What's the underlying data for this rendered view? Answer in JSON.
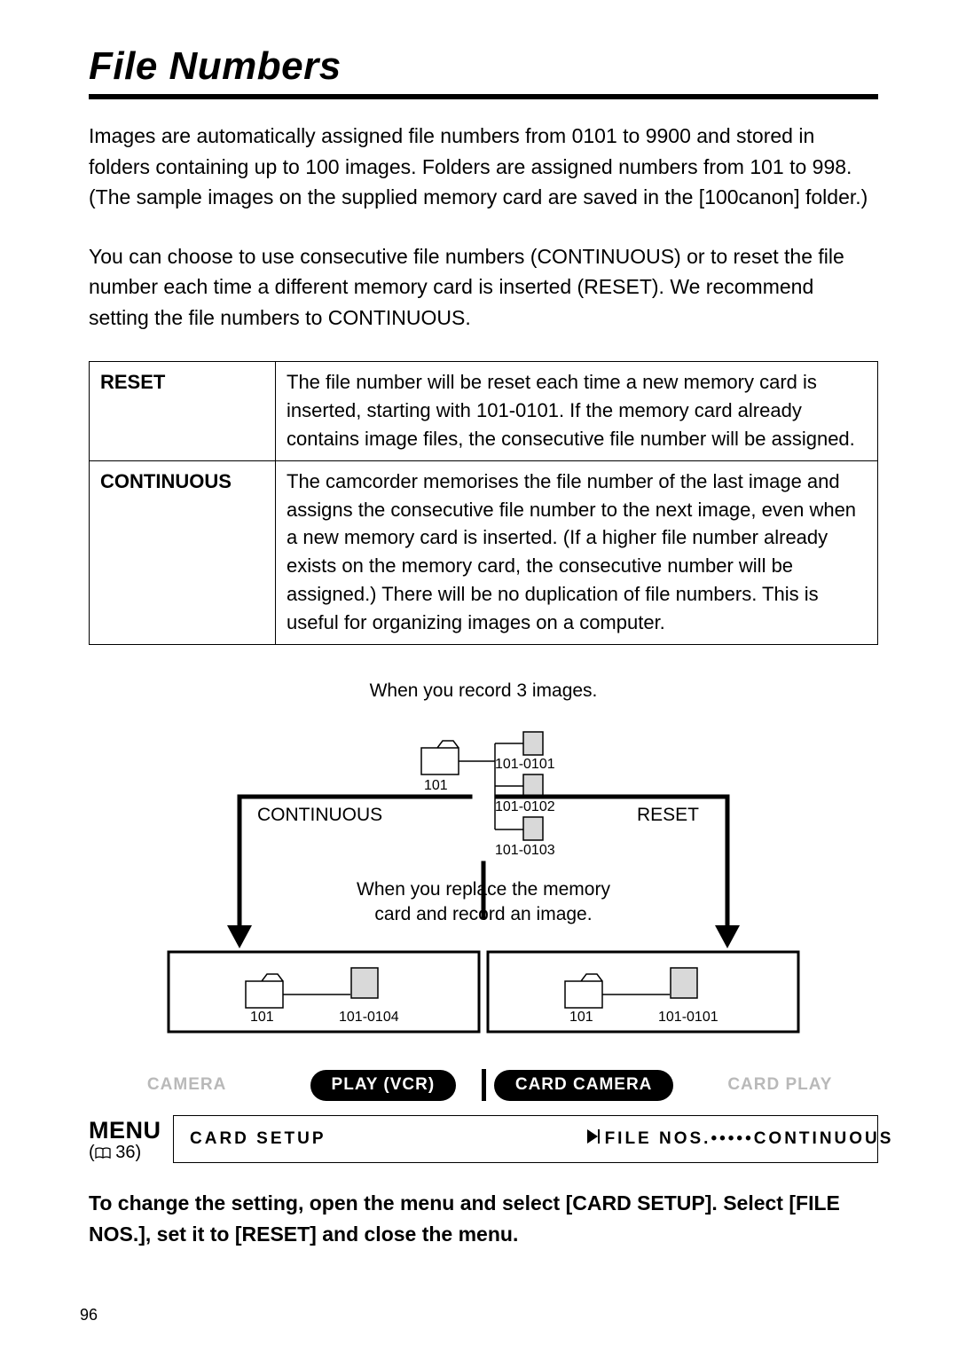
{
  "page": {
    "title": "File Numbers",
    "para1": "Images are automatically assigned file numbers from 0101 to 9900 and stored in folders containing up to 100 images. Folders are assigned numbers from 101 to 998. (The sample images on the supplied memory card are saved in the [100canon] folder.)",
    "para2": "You can choose to use consecutive file numbers (CONTINUOUS) or to reset the file number each time a different memory card is inserted (RESET). We recommend setting the file numbers to CONTINUOUS.",
    "table": {
      "rows": [
        {
          "label": "RESET",
          "desc": "The file number will be reset each time a new memory card is inserted, starting with 101-0101. If the memory card already contains image files, the consecutive file number will be assigned."
        },
        {
          "label": "CONTINUOUS",
          "desc": "The camcorder memorises the file number of the last image and assigns the consecutive file number to the next image, even when a new memory card is inserted. (If a higher file number already exists on the memory card, the consecutive number will be assigned.) There will be no duplication of file numbers. This is useful for organizing images on a computer."
        }
      ]
    },
    "diagram": {
      "caption": "When you record 3 images.",
      "continuous_label": "CONTINUOUS",
      "reset_label": "RESET",
      "folder_label": "101",
      "file1": "101-0101",
      "file2": "101-0102",
      "file3": "101-0103",
      "mid_text_l1": "When you replace the memory",
      "mid_text_l2": "card and record an image.",
      "left_folder": "101",
      "left_file": "101-0104",
      "right_folder": "101",
      "right_file": "101-0101"
    },
    "modes": {
      "camera": "CAMERA",
      "play_vcr": "PLAY (VCR)",
      "card_camera": "CARD CAMERA",
      "card_play": "CARD PLAY"
    },
    "menu": {
      "label": "MENU",
      "page_ref": "36",
      "left": "CARD SETUP",
      "right": "FILE NOS.•••••CONTINUOUS"
    },
    "instruction": "To change the setting, open the menu and select [CARD SETUP]. Select [FILE NOS.], set it to [RESET] and close the menu.",
    "page_number": "96"
  }
}
